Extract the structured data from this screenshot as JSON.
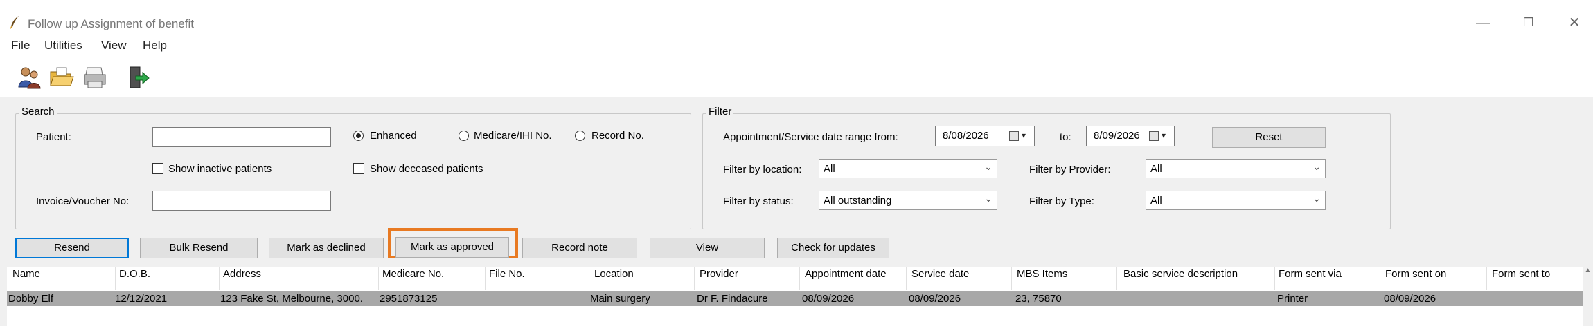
{
  "window": {
    "title": "Follow up Assignment of benefit",
    "controls": {
      "minimize": "—",
      "restore": "❐",
      "close": "✕"
    }
  },
  "menu": [
    "File",
    "Utilities",
    "View",
    "Help"
  ],
  "toolbar": {
    "icons": [
      "patients-icon",
      "open-folder-icon",
      "printer-icon",
      "exit-door-icon"
    ]
  },
  "search": {
    "group_title": "Search",
    "patient_label": "Patient:",
    "patient_value": "",
    "radio_enhanced": "Enhanced",
    "radio_medicare": "Medicare/IHI No.",
    "radio_record": "Record No.",
    "selected_radio": "Enhanced",
    "show_inactive": "Show inactive patients",
    "show_deceased": "Show deceased patients",
    "invoice_label": "Invoice/Voucher No:",
    "invoice_value": ""
  },
  "filter": {
    "group_title": "Filter",
    "date_range_label": "Appointment/Service date range from:",
    "date_from": "8/08/2026",
    "to_label": "to:",
    "date_to": "8/09/2026",
    "reset_label": "Reset",
    "location_label": "Filter by location:",
    "location_value": "All",
    "provider_label": "Filter by Provider:",
    "provider_value": "All",
    "status_label": "Filter by status:",
    "status_value": "All outstanding",
    "type_label": "Filter by Type:",
    "type_value": "All"
  },
  "actions": {
    "resend": "Resend",
    "bulk_resend": "Bulk Resend",
    "mark_declined": "Mark as declined",
    "mark_approved": "Mark as approved",
    "record_note": "Record note",
    "view": "View",
    "check_updates": "Check for updates"
  },
  "table": {
    "columns": [
      "Name",
      "D.O.B.",
      "Address",
      "Medicare No.",
      "File No.",
      "Location",
      "Provider",
      "Appointment date",
      "Service date",
      "MBS Items",
      "Basic service description",
      "Form sent via",
      "Form sent on",
      "Form sent to"
    ],
    "rows": [
      [
        "Dobby Elf",
        "12/12/2021",
        "123 Fake St, Melbourne, 3000.",
        "2951873125",
        "",
        "Main surgery",
        "Dr F. Findacure",
        "08/09/2026",
        "08/09/2026",
        "23, 75870",
        "",
        "Printer",
        "08/09/2026",
        ""
      ]
    ]
  },
  "colors": {
    "highlight": "#e87a22",
    "selected_row": "#a8a8a8",
    "default_button_border": "#0078d7",
    "panel_bg": "#f0f0f0"
  }
}
